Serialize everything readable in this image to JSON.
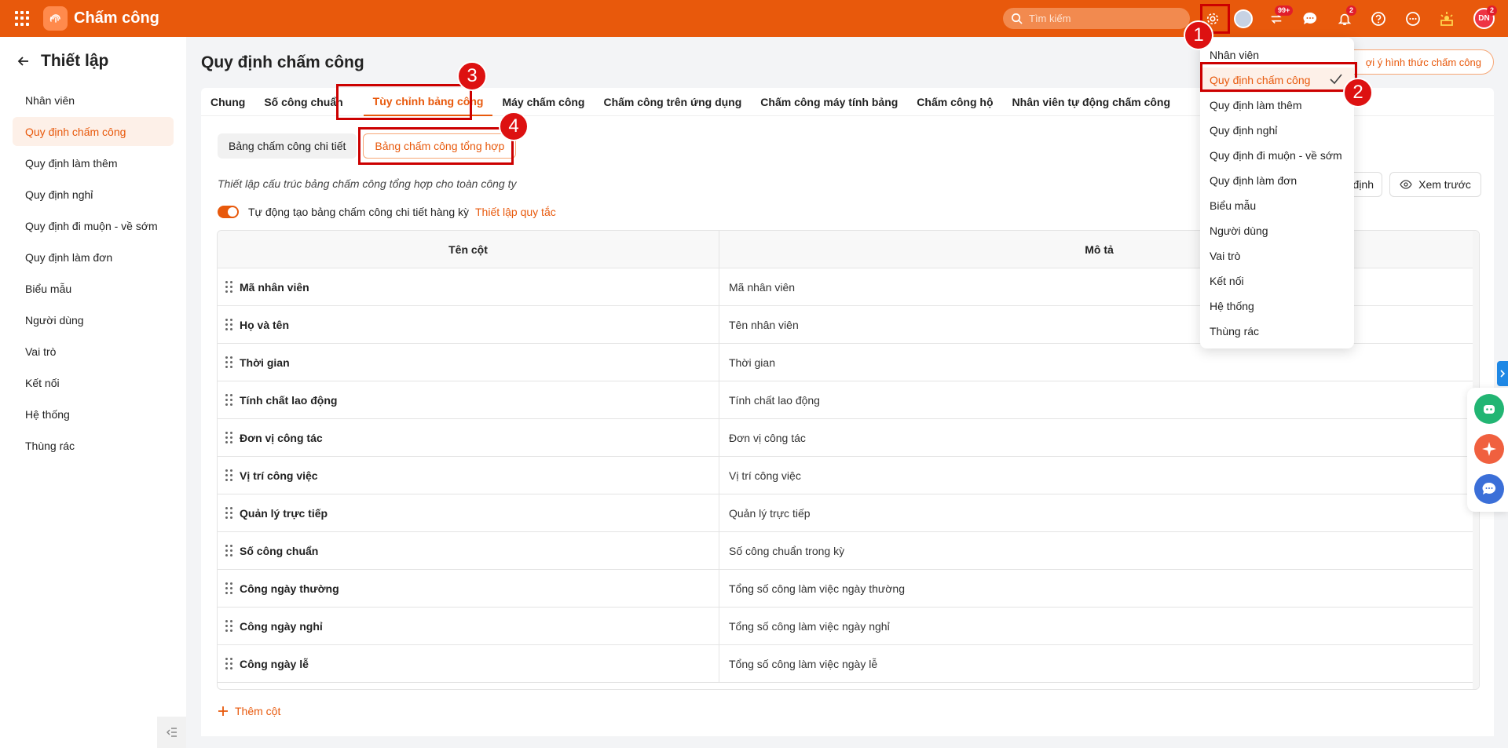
{
  "app": {
    "title": "Chấm công"
  },
  "search": {
    "placeholder": "Tìm kiếm"
  },
  "topbar": {
    "badge_apps": "99+",
    "badge_notifications": "2",
    "badge_avatar": "2",
    "avatar_initials": "DN"
  },
  "sidebar": {
    "title": "Thiết lập",
    "items": [
      {
        "label": "Nhân viên"
      },
      {
        "label": "Quy định chấm công"
      },
      {
        "label": "Quy định làm thêm"
      },
      {
        "label": "Quy định nghỉ"
      },
      {
        "label": "Quy định đi muộn - về sớm"
      },
      {
        "label": "Quy định làm đơn"
      },
      {
        "label": "Biểu mẫu"
      },
      {
        "label": "Người dùng"
      },
      {
        "label": "Vai trò"
      },
      {
        "label": "Kết nối"
      },
      {
        "label": "Hệ thống"
      },
      {
        "label": "Thùng rác"
      }
    ],
    "active_index": 1
  },
  "main": {
    "page_title": "Quy định chấm công",
    "right_action": "ợi ý hình thức chấm công",
    "tabs": [
      {
        "label": "Chung"
      },
      {
        "label": "Số công chuẩn"
      },
      {
        "label": "Tùy chỉnh bảng công"
      },
      {
        "label": "Máy chấm công"
      },
      {
        "label": "Chấm công trên ứng dụng"
      },
      {
        "label": "Chấm công máy tính bảng"
      },
      {
        "label": "Chấm công hộ"
      },
      {
        "label": "Nhân viên tự động chấm công"
      }
    ],
    "subtabs": [
      {
        "label": "Bảng chấm công chi tiết"
      },
      {
        "label": "Bảng chấm công tổng hợp"
      }
    ],
    "description": "Thiết lập cấu trúc bảng chấm công tổng hợp cho toàn công ty",
    "toggle_label": "Tự động tạo bảng chấm công chi tiết hàng kỳ",
    "rule_link": "Thiết lập quy tắc",
    "btn_fixed": "định",
    "btn_preview": "Xem trước",
    "add_column": "Thêm cột"
  },
  "table": {
    "headers": [
      "Tên cột",
      "Mô tả"
    ],
    "rows": [
      {
        "name": "Mã nhân viên",
        "desc": "Mã nhân viên"
      },
      {
        "name": "Họ và tên",
        "desc": "Tên nhân viên"
      },
      {
        "name": "Thời gian",
        "desc": "Thời gian"
      },
      {
        "name": "Tính chất lao động",
        "desc": "Tính chất lao động"
      },
      {
        "name": "Đơn vị công tác",
        "desc": "Đơn vị công tác"
      },
      {
        "name": "Vị trí công việc",
        "desc": "Vị trí công việc"
      },
      {
        "name": "Quản lý trực tiếp",
        "desc": "Quản lý trực tiếp"
      },
      {
        "name": "Số công chuẩn",
        "desc": "Số công chuẩn trong kỳ"
      },
      {
        "name": "Công ngày thường",
        "desc": "Tổng số công làm việc ngày thường"
      },
      {
        "name": "Công ngày nghỉ",
        "desc": "Tổng số công làm việc ngày nghỉ"
      },
      {
        "name": "Công ngày lễ",
        "desc": "Tổng số công làm việc ngày lễ"
      }
    ]
  },
  "dropdown": {
    "items": [
      {
        "label": "Nhân viên"
      },
      {
        "label": "Quy định chấm công"
      },
      {
        "label": "Quy định làm thêm"
      },
      {
        "label": "Quy định nghỉ"
      },
      {
        "label": "Quy định đi muộn - về sớm"
      },
      {
        "label": "Quy định làm đơn"
      },
      {
        "label": "Biểu mẫu"
      },
      {
        "label": "Người dùng"
      },
      {
        "label": "Vai trò"
      },
      {
        "label": "Kết nối"
      },
      {
        "label": "Hệ thống"
      },
      {
        "label": "Thùng rác"
      }
    ]
  },
  "annotations": [
    "1",
    "2",
    "3",
    "4"
  ],
  "colors": {
    "accent": "#e8590c",
    "annotation": "#cc1111"
  }
}
